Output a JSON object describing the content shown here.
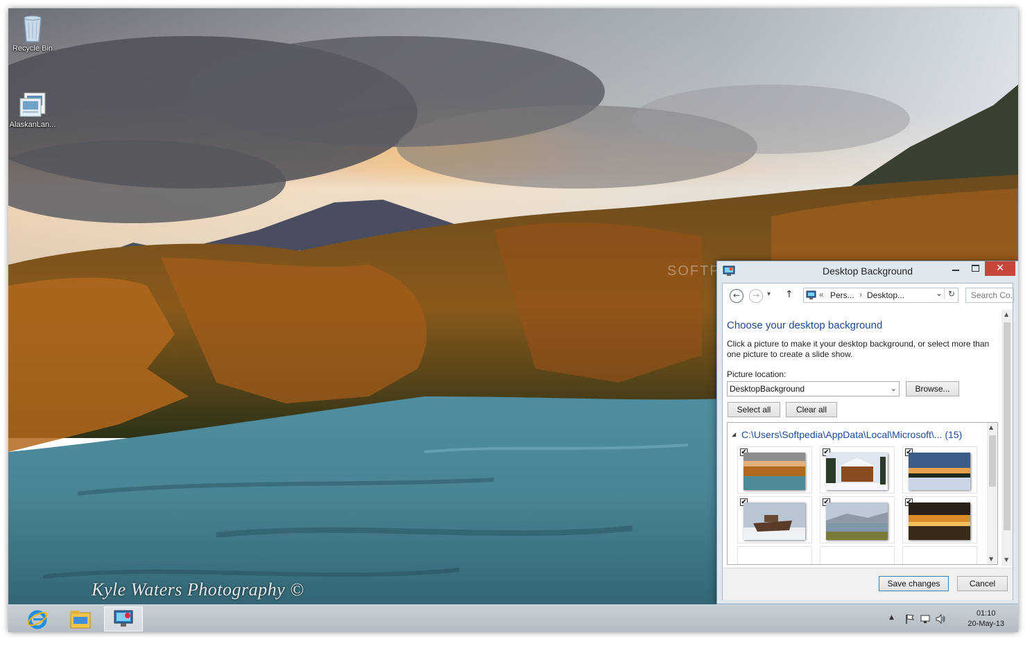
{
  "desktop": {
    "icons": [
      {
        "label": "Recycle Bin"
      },
      {
        "label": "AlaskanLan..."
      }
    ],
    "wallpaper_credit": "Kyle Waters Photography ©",
    "watermark": "SOFTPEDIA"
  },
  "dialog": {
    "title": "Desktop Background",
    "minimize_icon": "minimize-icon",
    "maximize_icon": "maximize-icon",
    "close_glyph": "✕",
    "nav": {
      "back_glyph": "←",
      "forward_glyph": "→",
      "recent_glyph": "▾",
      "up_glyph": "↑",
      "breadcrumb": [
        "Pers...",
        "Desktop..."
      ],
      "crumb_prefix": "«",
      "separator": "›",
      "dropdown_glyph": "⌄",
      "refresh_glyph": "↻",
      "search_placeholder": "Search Co..."
    },
    "heading": "Choose your desktop background",
    "description": "Click a picture to make it your desktop background, or select more than one picture to create a slide show.",
    "picture_location_label": "Picture location:",
    "picture_location_value": "DesktopBackground",
    "browse_label": "Browse...",
    "select_all_label": "Select all",
    "clear_all_label": "Clear all",
    "folder": {
      "path": "C:\\Users\\Softpedia\\AppData\\Local\\Microsoft\\...",
      "count": "(15)",
      "collapse_glyph": "◢"
    },
    "thumbnails": [
      {
        "name": "river-autumn",
        "checked": true
      },
      {
        "name": "snowy-cabin",
        "checked": true
      },
      {
        "name": "winter-sunset",
        "checked": true
      },
      {
        "name": "boat-snow",
        "checked": true
      },
      {
        "name": "lake-mountains",
        "checked": true
      },
      {
        "name": "lake-sunset",
        "checked": true
      }
    ],
    "check_glyph": "✔",
    "save_label": "Save changes",
    "cancel_label": "Cancel"
  },
  "taskbar": {
    "apps": [
      {
        "name": "internet-explorer-icon"
      },
      {
        "name": "file-explorer-icon"
      },
      {
        "name": "control-panel-icon",
        "active": true
      }
    ],
    "tray": {
      "show_hidden_glyph": "▲",
      "time": "01:10",
      "date": "20-May-13"
    }
  },
  "colors": {
    "accent_heading": "#1e4a99",
    "close_button": "#c7463b",
    "dialog_frame": "#dfe7ef",
    "taskbar": "#c1c8d0"
  }
}
